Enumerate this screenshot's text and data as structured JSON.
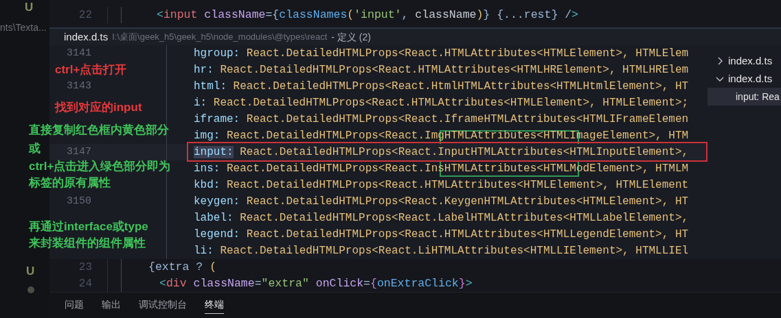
{
  "explorer": {
    "status_top": "U",
    "path": "nts\\Texta...",
    "status_bottom": "U",
    "modified_dot": true
  },
  "editor_top": [
    {
      "number": "22",
      "tokens": [
        {
          "kind": "bracket",
          "text": "<"
        },
        {
          "kind": "tag",
          "text": "input"
        },
        {
          "kind": "attr",
          "text": " className"
        },
        {
          "kind": "punct",
          "text": "={"
        },
        {
          "kind": "func",
          "text": "classNames"
        },
        {
          "kind": "paren",
          "text": "("
        },
        {
          "kind": "string",
          "text": "'input'"
        },
        {
          "kind": "punct",
          "text": ", "
        },
        {
          "kind": "var",
          "text": "className"
        },
        {
          "kind": "paren",
          "text": ")"
        },
        {
          "kind": "punct",
          "text": "} {...rest} /"
        },
        {
          "kind": "bracket",
          "text": ">"
        }
      ]
    }
  ],
  "peek": {
    "file": "index.d.ts",
    "path": "I:\\桌面\\geek_h5\\geek_h5\\node_modules\\@types\\react",
    "suffix": "- 定义 (2)",
    "lines": [
      {
        "number": "3141",
        "property": "hgroup:",
        "type": "React.DetailedHTMLProps<React.HTMLAttributes<HTMLElement>, HTMLElem",
        "highlighted": false
      },
      {
        "property": "hr:",
        "type": "React.DetailedHTMLProps<React.HTMLAttributes<HTMLHRElement>, HTMLHRElem",
        "highlighted": false
      },
      {
        "number": "3143",
        "property": "html:",
        "type": "React.DetailedHTMLProps<React.HtmlHTMLAttributes<HTMLHtmlElement>, HT",
        "highlighted": false
      },
      {
        "property": "i:",
        "type": "React.DetailedHTMLProps<React.HTMLAttributes<HTMLElement>, HTMLElement>;",
        "highlighted": false
      },
      {
        "property": "iframe:",
        "type": "React.DetailedHTMLProps<React.IframeHTMLAttributes<HTMLIFrameElemen",
        "highlighted": false
      },
      {
        "property": "img:",
        "type": "React.DetailedHTMLProps<React.ImgHTMLAttributes<HTMLImageElement>, HTM",
        "highlighted": false
      },
      {
        "number": "3147",
        "property": "input:",
        "type": "React.DetailedHTMLProps<React.InputHTMLAttributes<HTMLInputElement>,",
        "highlighted": true
      },
      {
        "property": "ins:",
        "type": "React.DetailedHTMLProps<React.InsHTMLAttributes<HTMLModElement>, HTMLM",
        "highlighted": false
      },
      {
        "property": "kbd:",
        "type": "React.DetailedHTMLProps<React.HTMLAttributes<HTMLElement>, HTMLElement",
        "highlighted": false
      },
      {
        "number": "3150",
        "property": "keygen:",
        "type": "React.DetailedHTMLProps<React.KeygenHTMLAttributes<HTMLElement>, HT",
        "highlighted": false
      },
      {
        "property": "label:",
        "type": "React.DetailedHTMLProps<React.LabelHTMLAttributes<HTMLLabelElement>,",
        "highlighted": false
      },
      {
        "property": "legend:",
        "type": "React.DetailedHTMLProps<React.HTMLAttributes<HTMLLegendElement>, HT",
        "highlighted": false
      },
      {
        "property": "li:",
        "type": "React.DetailedHTMLProps<React.LiHTMLAttributes<HTMLLIElement>, HTMLLIEl",
        "highlighted": false
      }
    ],
    "references": [
      {
        "file": "index.d.ts",
        "expanded": false
      },
      {
        "file": "index.d.ts",
        "expanded": true,
        "children": [
          {
            "label": "input: Rea",
            "selected": true
          }
        ]
      }
    ]
  },
  "annotations": [
    {
      "kind": "red",
      "text": "ctrl+点击打开"
    },
    {
      "kind": "red",
      "text": "找到对应的input"
    },
    {
      "kind": "green",
      "text": "直接复制红色框内黄色部分"
    },
    {
      "kind": "green",
      "text": "或"
    },
    {
      "kind": "green",
      "text": "ctrl+点击进入绿色部分即为"
    },
    {
      "kind": "green",
      "text": "标签的原有属性"
    },
    {
      "kind": "green",
      "text": "再通过interface或type"
    },
    {
      "kind": "green",
      "text": "来封装组件的组件属性"
    }
  ],
  "editor_bottom": [
    {
      "number": "23",
      "tokens": [
        {
          "kind": "punct",
          "text": "{extra ? "
        },
        {
          "kind": "paren",
          "text": "("
        }
      ]
    },
    {
      "number": "24",
      "tokens": [
        {
          "kind": "bracket",
          "text": "<"
        },
        {
          "kind": "tag",
          "text": "div"
        },
        {
          "kind": "attr",
          "text": " className"
        },
        {
          "kind": "punct",
          "text": "="
        },
        {
          "kind": "string",
          "text": "\"extra\""
        },
        {
          "kind": "attr",
          "text": " onClick"
        },
        {
          "kind": "punct",
          "text": "="
        },
        {
          "kind": "brace",
          "text": "{"
        },
        {
          "kind": "func",
          "text": "onExtraClick"
        },
        {
          "kind": "brace",
          "text": "}"
        },
        {
          "kind": "bracket",
          "text": ">"
        }
      ]
    }
  ],
  "panel_tabs": [
    {
      "label": "问题",
      "selected": false
    },
    {
      "label": "输出",
      "selected": false
    },
    {
      "label": "调试控制台",
      "selected": false
    },
    {
      "label": "终端",
      "selected": true
    }
  ]
}
